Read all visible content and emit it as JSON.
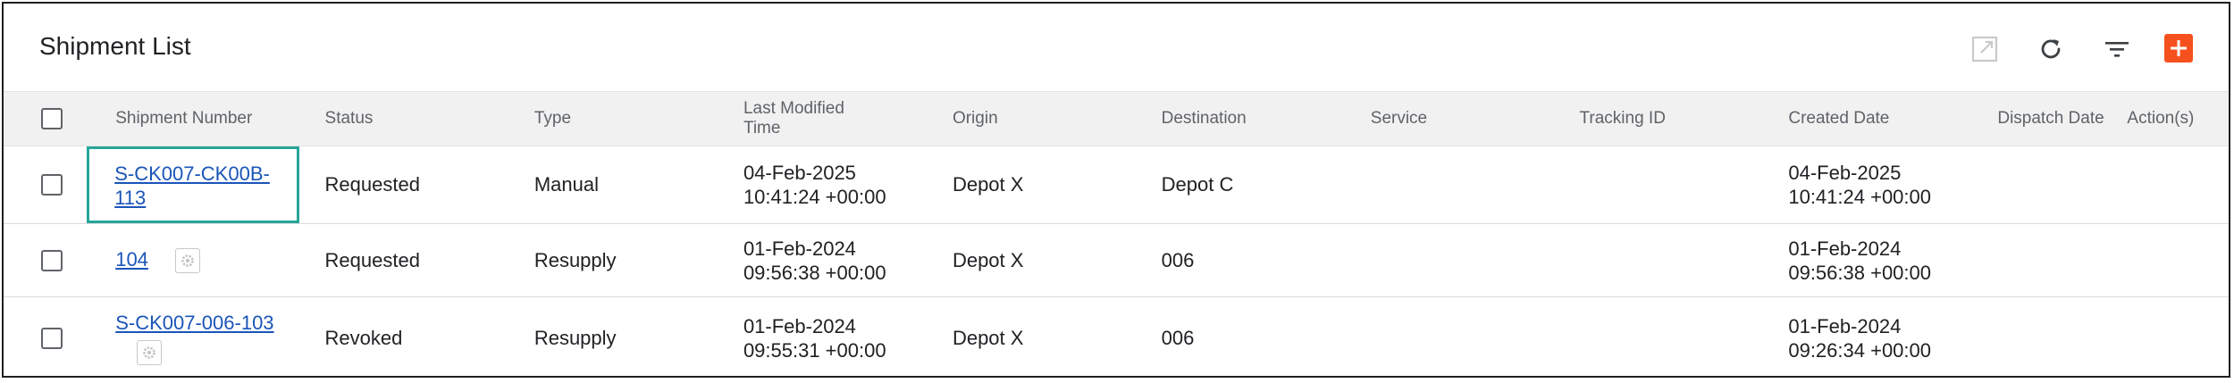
{
  "header": {
    "title": "Shipment List",
    "icons": [
      "external-link-icon",
      "refresh-icon",
      "filter-icon",
      "add-icon"
    ],
    "accent_color": "#f4511e"
  },
  "table": {
    "columns": [
      "Shipment Number",
      "Status",
      "Type",
      "Last Modified Time",
      "Origin",
      "Destination",
      "Service",
      "Tracking ID",
      "Created Date",
      "Dispatch Date",
      "Action(s)"
    ],
    "last_modified_line1": "Last Modified",
    "last_modified_line2": "Time",
    "rows": [
      {
        "number": "S-CK007-CK00B-113",
        "number_line1": "S-CK007-CK00B-",
        "number_line2": "113",
        "status": "Requested",
        "type": "Manual",
        "modified_date": "04-Feb-2025",
        "modified_time": "10:41:24 +00:00",
        "origin": "Depot X",
        "destination": "Depot C",
        "service": "",
        "tracking_id": "",
        "created_date": "04-Feb-2025",
        "created_time": "10:41:24 +00:00",
        "dispatch_date": ""
      },
      {
        "number": "104",
        "status": "Requested",
        "type": "Resupply",
        "modified_date": "01-Feb-2024",
        "modified_time": "09:56:38 +00:00",
        "origin": "Depot X",
        "destination": "006",
        "service": "",
        "tracking_id": "",
        "created_date": "01-Feb-2024",
        "created_time": "09:56:38 +00:00",
        "dispatch_date": ""
      },
      {
        "number": "S-CK007-006-103",
        "status": "Revoked",
        "type": "Resupply",
        "modified_date": "01-Feb-2024",
        "modified_time": "09:55:31 +00:00",
        "origin": "Depot X",
        "destination": "006",
        "service": "",
        "tracking_id": "",
        "created_date": "01-Feb-2024",
        "created_time": "09:26:34 +00:00",
        "dispatch_date": ""
      }
    ]
  }
}
